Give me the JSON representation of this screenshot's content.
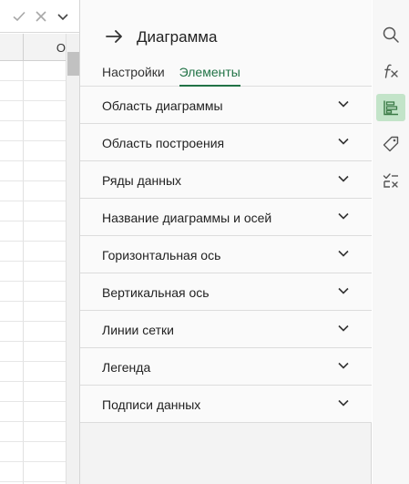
{
  "sheet": {
    "column_letter": "O"
  },
  "panel": {
    "title": "Диаграмма",
    "tabs": [
      {
        "label": "Настройки",
        "active": false
      },
      {
        "label": "Элементы",
        "active": true
      }
    ],
    "sections": [
      {
        "label": "Область диаграммы"
      },
      {
        "label": "Область построения"
      },
      {
        "label": "Ряды данных"
      },
      {
        "label": "Название диаграммы и осей"
      },
      {
        "label": "Горизонтальная ось"
      },
      {
        "label": "Вертикальная ось"
      },
      {
        "label": "Линии сетки"
      },
      {
        "label": "Легенда"
      },
      {
        "label": "Подписи данных"
      }
    ]
  },
  "rail": {
    "buttons": [
      {
        "icon": "search-icon",
        "active": false
      },
      {
        "icon": "function-icon",
        "active": false
      },
      {
        "icon": "chart-format-icon",
        "active": true
      },
      {
        "icon": "tag-icon",
        "active": false
      },
      {
        "icon": "clear-format-icon",
        "active": false
      }
    ]
  },
  "colors": {
    "accent": "#217346",
    "active_rail_bg": "#c3e4c9",
    "panel_bg": "#f3f3f3"
  }
}
